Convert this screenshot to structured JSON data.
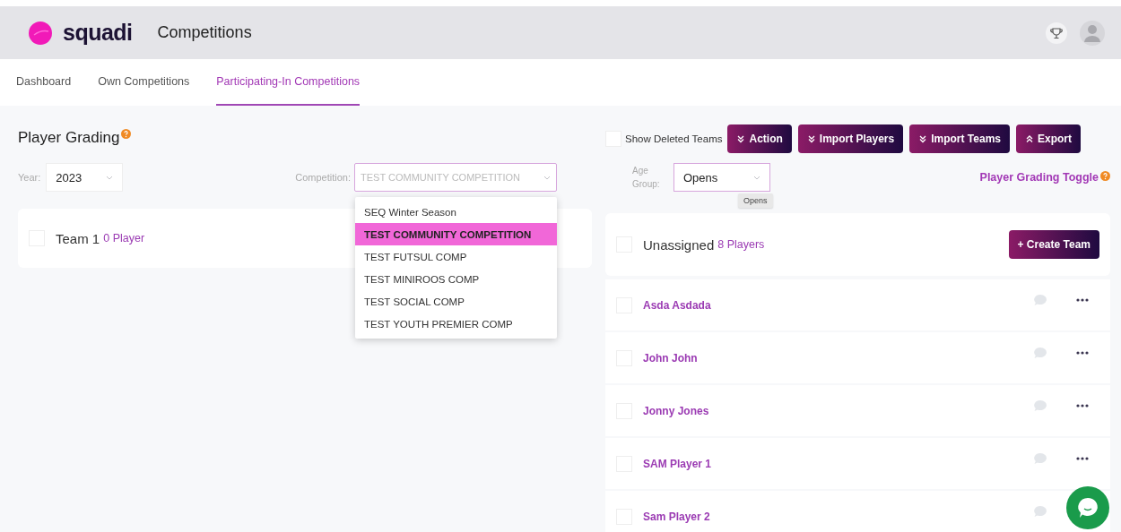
{
  "header": {
    "brand": "squadi",
    "title": "Competitions"
  },
  "tabs": [
    {
      "label": "Dashboard",
      "selected": false
    },
    {
      "label": "Own Competitions",
      "selected": false
    },
    {
      "label": "Participating-In Competitions",
      "selected": true
    }
  ],
  "page_title": "Player Grading",
  "filters": {
    "year_label": "Year:",
    "year": "2023",
    "competition_label": "Competition:",
    "competition": "TEST COMMUNITY COMPETITION",
    "age_group_label": "Age Group:",
    "age_group": "Opens",
    "age_group_tooltip": "Opens"
  },
  "competition_options": [
    {
      "label": "SEQ Winter Season",
      "selected": false
    },
    {
      "label": "TEST COMMUNITY COMPETITION",
      "selected": true
    },
    {
      "label": "TEST FUTSUL COMP",
      "selected": false
    },
    {
      "label": "TEST MINIROOS COMP",
      "selected": false
    },
    {
      "label": "TEST SOCIAL COMP",
      "selected": false
    },
    {
      "label": "TEST YOUTH PREMIER COMP",
      "selected": false
    }
  ],
  "show_deleted_teams": {
    "label": "Show Deleted Teams",
    "checked": false
  },
  "actions": [
    {
      "label": "Action",
      "kind": "down"
    },
    {
      "label": "Import Players",
      "kind": "down"
    },
    {
      "label": "Import Teams",
      "kind": "down"
    },
    {
      "label": "Export",
      "kind": "up"
    }
  ],
  "toggle_link": "Player Grading Toggle",
  "teams": [
    {
      "name": "Team 1",
      "count": "0 Player",
      "checked": false
    }
  ],
  "unassigned": {
    "name": "Unassigned",
    "count": "8 Players",
    "checked": false,
    "create_button": "+ Create Team"
  },
  "players": [
    {
      "name": "Asda Asdada",
      "checked": false
    },
    {
      "name": "John John",
      "checked": false
    },
    {
      "name": "Jonny Jones",
      "checked": false
    },
    {
      "name": "SAM Player 1",
      "checked": false
    },
    {
      "name": "Sam Player 2",
      "checked": false
    }
  ]
}
